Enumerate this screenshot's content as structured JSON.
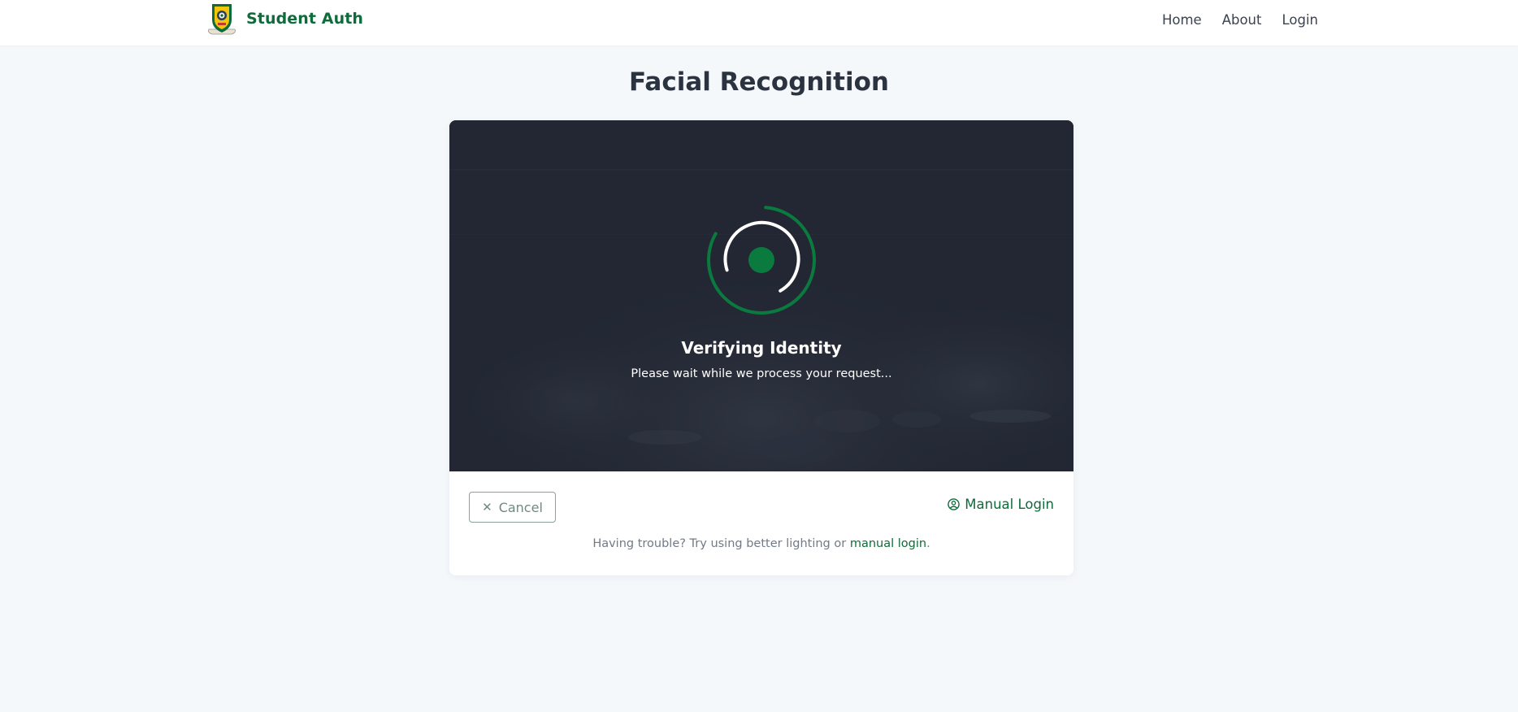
{
  "navbar": {
    "brand": "Student Auth",
    "links": [
      {
        "label": "Home"
      },
      {
        "label": "About"
      },
      {
        "label": "Login"
      }
    ]
  },
  "page": {
    "title": "Facial Recognition"
  },
  "camera": {
    "status_title": "Verifying Identity",
    "status_subtitle": "Please wait while we process your request..."
  },
  "actions": {
    "cancel_label": "Cancel",
    "cancel_icon": "close-icon",
    "manual_login_label": "Manual Login",
    "manual_login_icon": "user-circle-icon"
  },
  "help": {
    "prefix": "Having trouble? Try using better lighting or ",
    "link": "manual login",
    "suffix": "."
  },
  "colors": {
    "brand_green": "#0f6b3a",
    "loader_green": "#0a7a3f",
    "camera_bg": "#232834",
    "page_bg": "#f4f8fb"
  }
}
